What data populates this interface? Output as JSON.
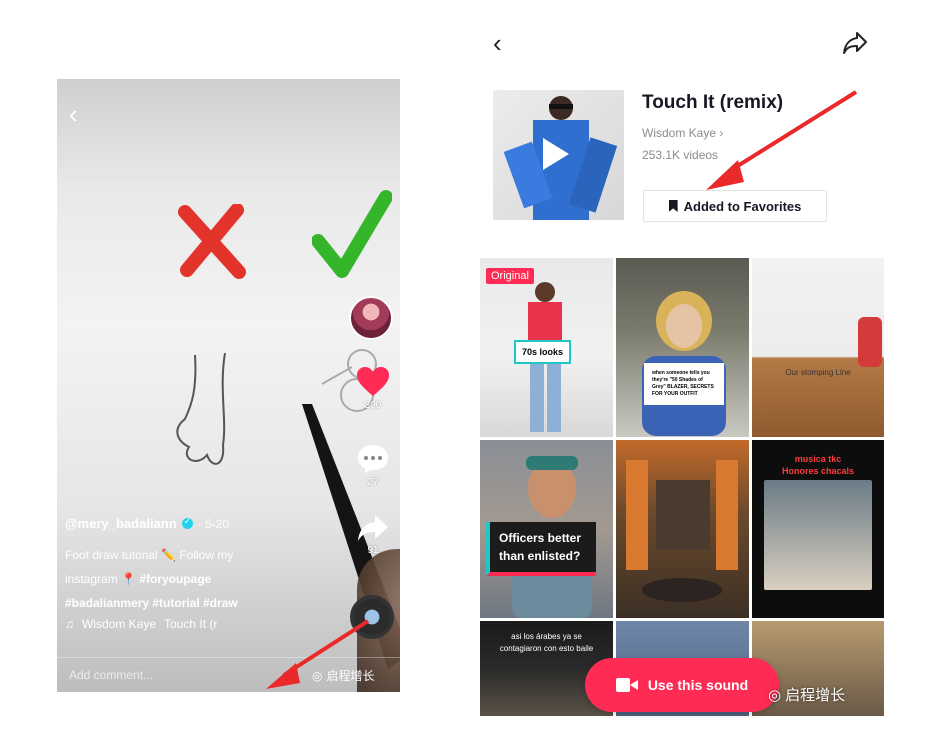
{
  "left": {
    "username": "@mery_badaliann",
    "date": "· 5-20",
    "caption_line1": "Foot draw tutorial ✏️ Follow my",
    "caption_line2_prefix": "instagram 📍",
    "caption_tag1": "#foryoupage",
    "caption_tags": "#badalianmery #tutorial #draw",
    "music_artist": "Wisdom Kaye",
    "music_title": "Touch It (r",
    "likes": "300",
    "comments": "27",
    "shares": "91",
    "comment_placeholder": "Add comment...",
    "watermark": "启程增长"
  },
  "right": {
    "sound_title": "Touch It (remix)",
    "artist": "Wisdom Kaye",
    "video_count": "253.1K videos",
    "favorites_label": "Added to Favorites",
    "grid": {
      "c1_badge": "Original",
      "c1_label": "70s looks",
      "c2_label": "when someone tells you they're \"50 Shades of Grey\" BLAZER, SECRETS FOR YOUR OUTFIT",
      "c3_label": "Our stomping Line",
      "c4_label": "Officers better than enlisted?",
      "c6_title": "musica tkc",
      "c6_sub": "Honores chacals",
      "c7_label": "asi los árabes ya se contagiaron con esto baile"
    },
    "use_sound_label": "Use this sound",
    "watermark": "启程增长"
  },
  "colors": {
    "accent": "#fe2c55",
    "teal": "#21c7c7",
    "text_primary": "#161823",
    "text_secondary": "#8a8b91"
  }
}
